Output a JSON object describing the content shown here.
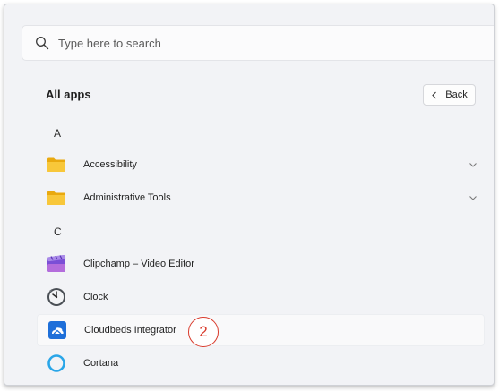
{
  "search": {
    "placeholder": "Type here to search"
  },
  "all_apps": {
    "title": "All apps",
    "back_label": "Back"
  },
  "groups": [
    {
      "letter": "A",
      "items": [
        {
          "label": "Accessibility",
          "icon": "folder-icon",
          "expandable": true
        },
        {
          "label": "Administrative Tools",
          "icon": "folder-icon",
          "expandable": true
        }
      ]
    },
    {
      "letter": "C",
      "items": [
        {
          "label": "Clipchamp – Video Editor",
          "icon": "clipchamp-icon",
          "expandable": false
        },
        {
          "label": "Clock",
          "icon": "clock-icon",
          "expandable": false
        },
        {
          "label": "Cloudbeds Integrator",
          "icon": "cloudbeds-icon",
          "expandable": false
        },
        {
          "label": "Cortana",
          "icon": "cortana-icon",
          "expandable": false
        }
      ]
    }
  ],
  "annotation": {
    "step_number": "2",
    "color": "#d93a2b"
  },
  "colors": {
    "folder": "#f5c12e",
    "cloudbeds": "#1e6fd9",
    "cortana": "#2aa6e8",
    "clipchamp": "#7b4fd6"
  }
}
